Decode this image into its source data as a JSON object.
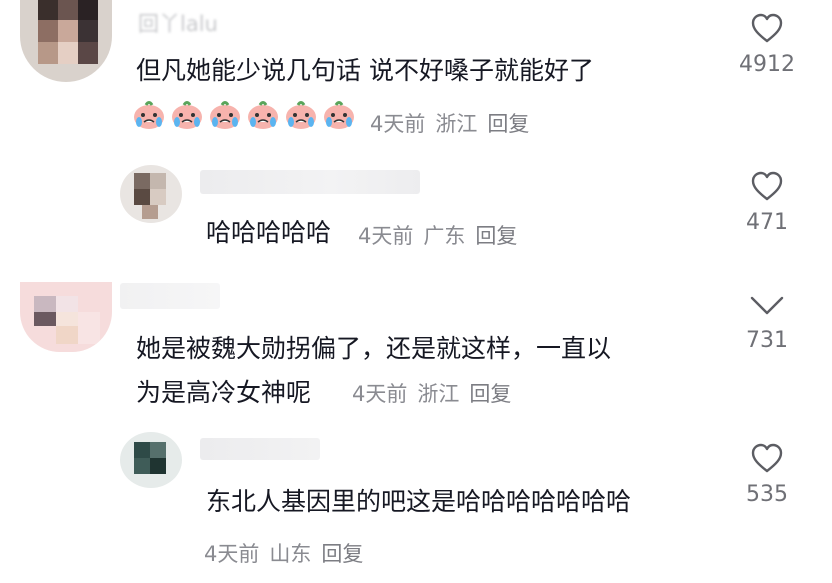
{
  "comments": [
    {
      "username": "回丫lalu",
      "text": "但凡她能少说几句话 说不好嗓子就能好了",
      "emoji_count": 6,
      "emoji_name": "crying-peach-emoji",
      "time": "4天前",
      "location": "浙江",
      "reply_label": "回复",
      "likes": "4912"
    },
    {
      "username": "",
      "text": "哈哈哈哈哈",
      "time": "4天前",
      "location": "广东",
      "reply_label": "回复",
      "likes": "471"
    },
    {
      "username": "",
      "text_line1": "她是被魏大勋拐偏了，还是就这样，一直以",
      "text_line2": "为是高冷女神呢",
      "time": "4天前",
      "location": "浙江",
      "reply_label": "回复",
      "likes": "731"
    },
    {
      "username": "",
      "text": "东北人基因里的吧这是哈哈哈哈哈哈哈",
      "time": "4天前",
      "location": "山东",
      "reply_label": "回复",
      "likes": "535"
    }
  ],
  "icons": {
    "like": "heart-outline-icon",
    "collapsed_like": "chevron-down-icon"
  },
  "colors": {
    "text": "#161823",
    "meta": "#8a8b91",
    "count": "#6f7076"
  }
}
